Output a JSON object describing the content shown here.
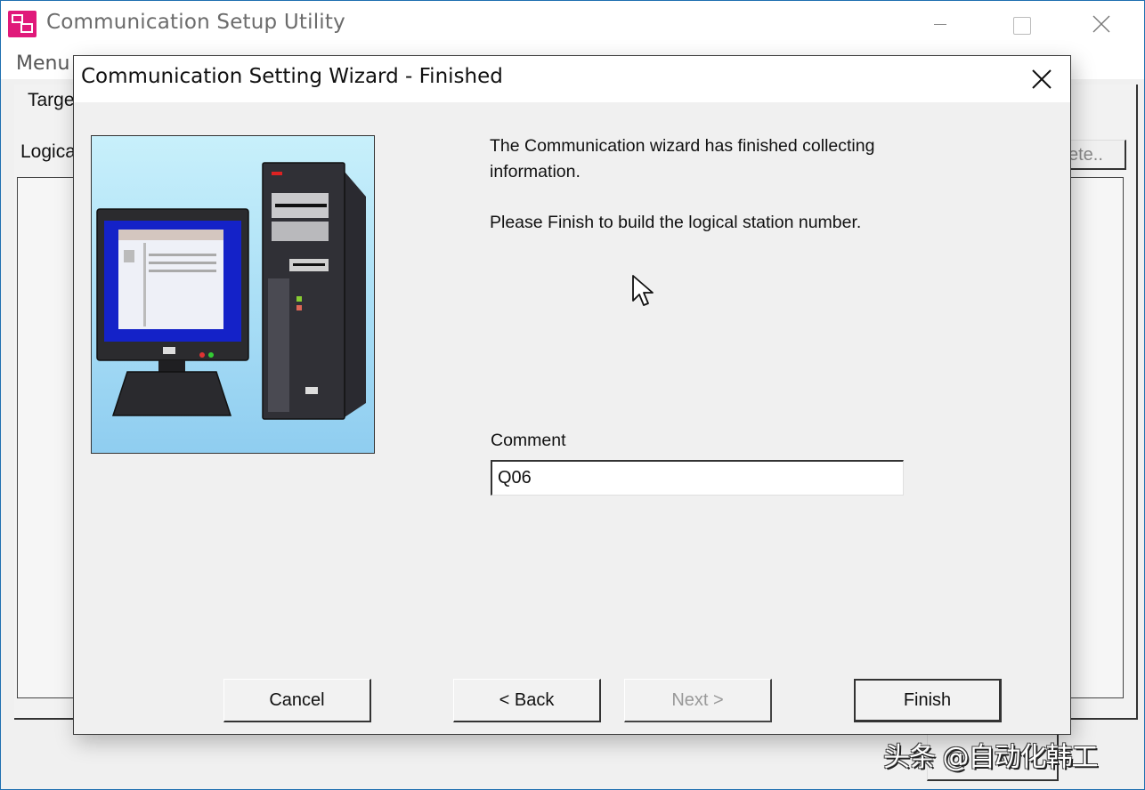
{
  "main_window": {
    "title": "Communication Setup Utility",
    "icon": "app-icon",
    "controls": [
      "minimize-icon",
      "maximize-icon",
      "close-icon"
    ],
    "menu": [
      "Menu"
    ],
    "tab_label_partial": "Targe",
    "logical_label_partial": "Logica",
    "delete_button_partial": "ete.."
  },
  "dialog": {
    "title": "Communication Setting Wizard - Finished",
    "close_icon": "close-icon",
    "illustration": "computer-illustration",
    "message_line1": "The Communication wizard has finished collecting information.",
    "message_line2": "Please Finish to build the logical station number.",
    "comment": {
      "label": "Comment",
      "value": "Q06"
    },
    "buttons": {
      "cancel": "Cancel",
      "back": "< Back",
      "next": "Next >",
      "finish": "Finish"
    },
    "next_enabled": false
  },
  "watermark": "头条 @自动化韩工",
  "colors": {
    "accent_window_border": "#1e6fb0",
    "app_icon": "#e0197a",
    "dialog_bg": "#f0f0f0",
    "disabled_text": "#999999"
  }
}
